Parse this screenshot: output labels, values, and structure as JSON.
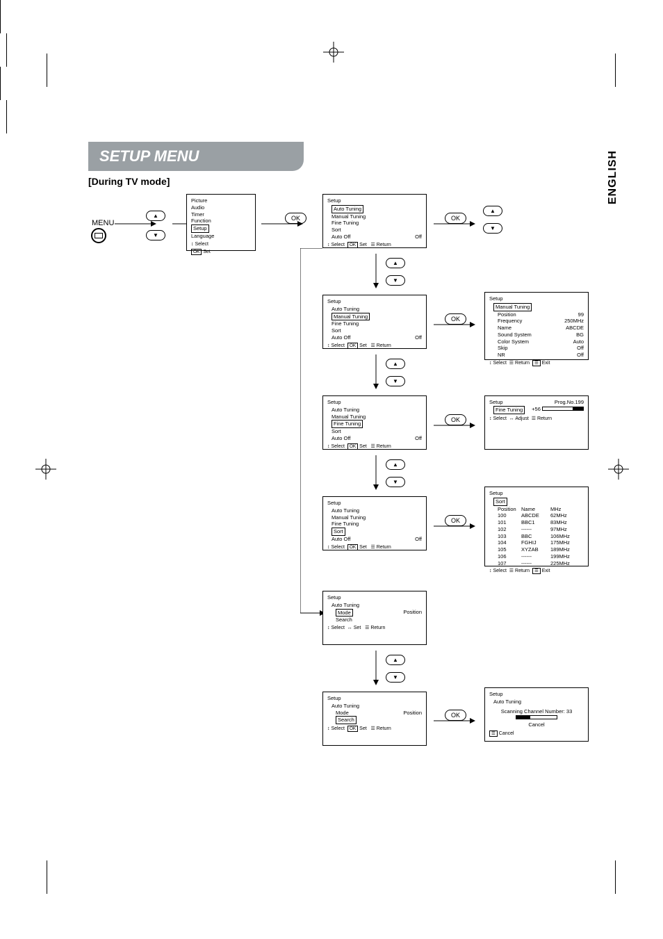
{
  "banner": "SETUP MENU",
  "subhead": "[During TV mode]",
  "language_tab": "ENGLISH",
  "menu_label": "MENU",
  "ok_label": "OK",
  "main_menu": {
    "items": [
      "Picture",
      "Audio",
      "Timer",
      "Function",
      "Setup",
      "Language"
    ],
    "highlighted": 4,
    "hints_select": "Select",
    "hints_set": "Set",
    "hints_set_key": "OK"
  },
  "setup_menu_base": {
    "title": "Setup",
    "items": [
      "Auto Tuning",
      "Manual Tuning",
      "Fine Tuning",
      "Sort",
      "Auto Off"
    ],
    "auto_off_val": "Off",
    "hints_select": "Select",
    "hints_set": "Set",
    "hints_set_key": "OK",
    "hints_return": "Return"
  },
  "setup_menu_hl_auto": {
    "highlighted": 0
  },
  "setup_menu_hl_manual": {
    "highlighted": 1
  },
  "setup_menu_hl_fine": {
    "highlighted": 2
  },
  "setup_menu_hl_sort": {
    "highlighted": 3
  },
  "manual_tuning_panel": {
    "title": "Setup",
    "subtitle": "Manual Tuning",
    "rows": [
      {
        "label": "Position",
        "value": "99"
      },
      {
        "label": "Frequency",
        "value": "250MHz"
      },
      {
        "label": "Name",
        "value": "ABCDE"
      },
      {
        "label": "Sound System",
        "value": "BG"
      },
      {
        "label": "Color System",
        "value": "Auto"
      },
      {
        "label": "Skip",
        "value": "Off"
      },
      {
        "label": "NR",
        "value": "Off"
      }
    ],
    "hints_select": "Select",
    "hints_return": "Return",
    "hints_exit": "Exit"
  },
  "fine_tuning_panel": {
    "title": "Setup",
    "subtitle": "Fine Tuning",
    "prog": "Prog.No.199",
    "value": "+56",
    "hints_select": "Select",
    "hints_adjust": "Adjust",
    "hints_return": "Return"
  },
  "sort_panel": {
    "title": "Setup",
    "subtitle": "Sort",
    "header": [
      "Position",
      "Name",
      "MHz"
    ],
    "rows": [
      [
        "100",
        "ABCDE",
        "62MHz"
      ],
      [
        "101",
        "BBC1",
        "83MHz"
      ],
      [
        "102",
        "------",
        "97MHz"
      ],
      [
        "103",
        "BBC",
        "106MHz"
      ],
      [
        "104",
        "FGHIJ",
        "175MHz"
      ],
      [
        "105",
        "XYZAB",
        "189MHz"
      ],
      [
        "106",
        "------",
        "199MHz"
      ],
      [
        "107",
        "------",
        "225MHz"
      ]
    ],
    "hints_select": "Select",
    "hints_return": "Return",
    "hints_exit": "Exit"
  },
  "auto_tuning_mode_panel": {
    "title": "Setup",
    "subtitle": "Auto Tuning",
    "rows": [
      {
        "label": "Mode",
        "value": "Position"
      },
      {
        "label": "Search",
        "value": ""
      }
    ],
    "highlighted": 0,
    "hints_select": "Select",
    "hints_set": "Set",
    "hints_return": "Return"
  },
  "auto_tuning_search_panel": {
    "title": "Setup",
    "subtitle": "Auto Tuning",
    "rows": [
      {
        "label": "Mode",
        "value": "Position"
      },
      {
        "label": "Search",
        "value": ""
      }
    ],
    "highlighted": 1,
    "hints_select": "Select",
    "hints_set": "Set",
    "hints_set_key": "OK",
    "hints_return": "Return"
  },
  "scanning_panel": {
    "title": "Setup",
    "subtitle": "Auto Tuning",
    "message": "Scanning Channel Number: 33",
    "cancel": "Cancel",
    "hints_cancel": "Cancel"
  }
}
